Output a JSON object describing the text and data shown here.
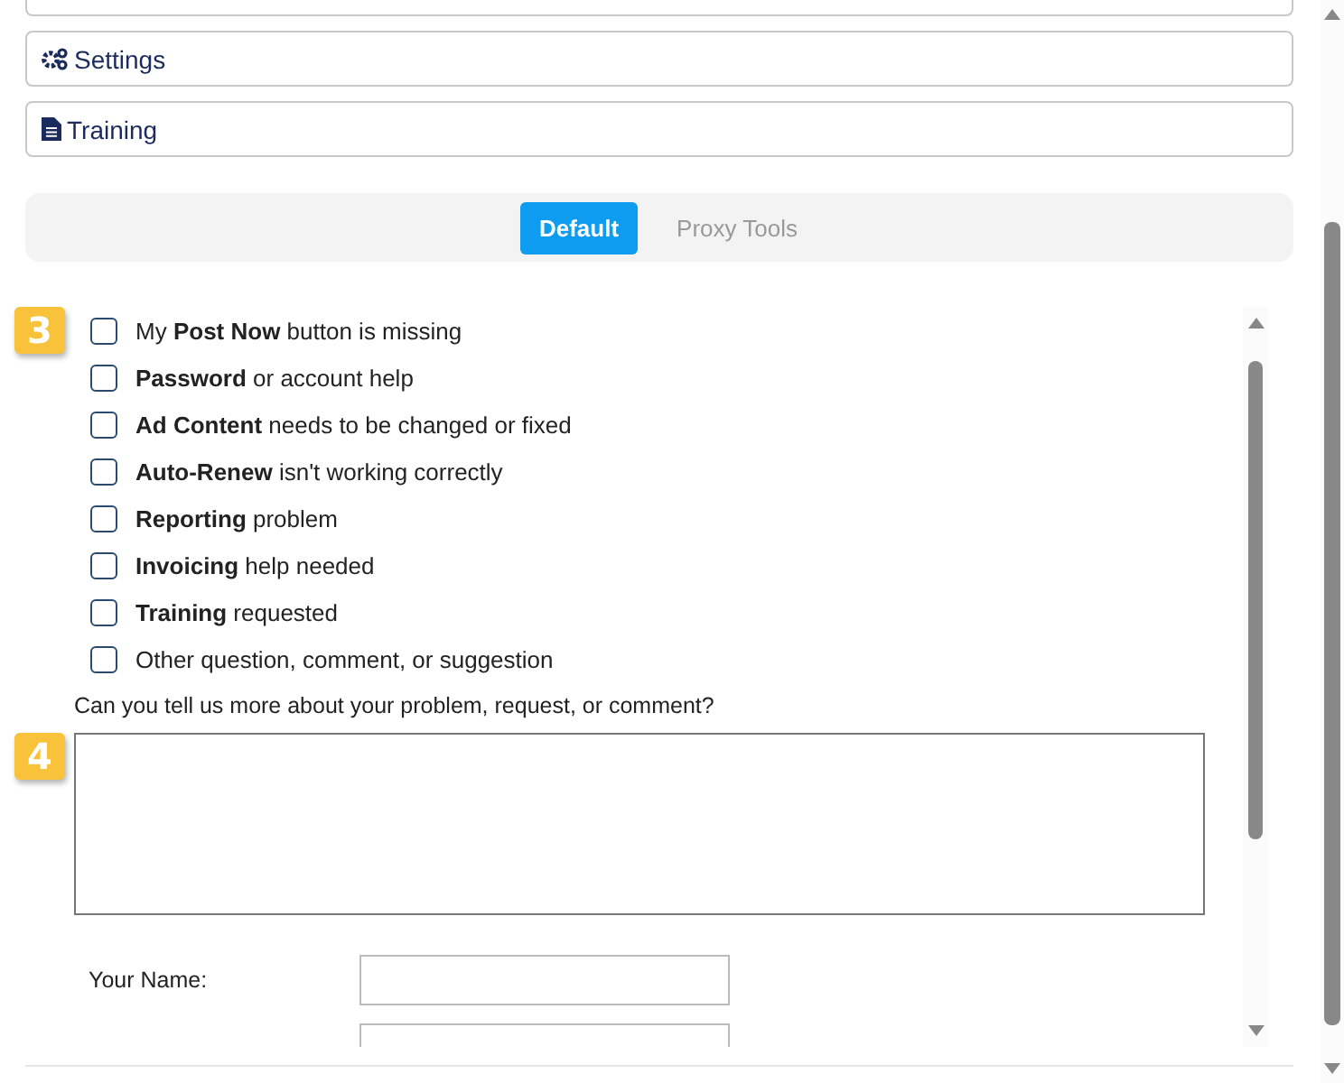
{
  "menu_items": [
    {
      "label": "Settings"
    },
    {
      "label": "Training"
    }
  ],
  "tabs": [
    {
      "label": "Default",
      "selected": true
    },
    {
      "label": "Proxy Tools",
      "selected": false
    }
  ],
  "badges": [
    "3",
    "4"
  ],
  "issues": [
    {
      "text": "My **Post Now** button is missing",
      "checked": false
    },
    {
      "text": "**Password** or account help",
      "checked": false
    },
    {
      "text": "**Ad Content** needs to be changed or fixed",
      "checked": false
    },
    {
      "text": "**Auto-Renew** isn't working correctly",
      "checked": false
    },
    {
      "text": "**Reporting** problem",
      "checked": false
    },
    {
      "text": "**Invoicing** help needed",
      "checked": false
    },
    {
      "text": "**Training** requested",
      "checked": false
    },
    {
      "text": "Other question, comment, or suggestion",
      "checked": false
    }
  ],
  "details_prompt": "Can you tell us more about your problem, request, or comment?",
  "name_field": {
    "label": "Your Name:"
  }
}
